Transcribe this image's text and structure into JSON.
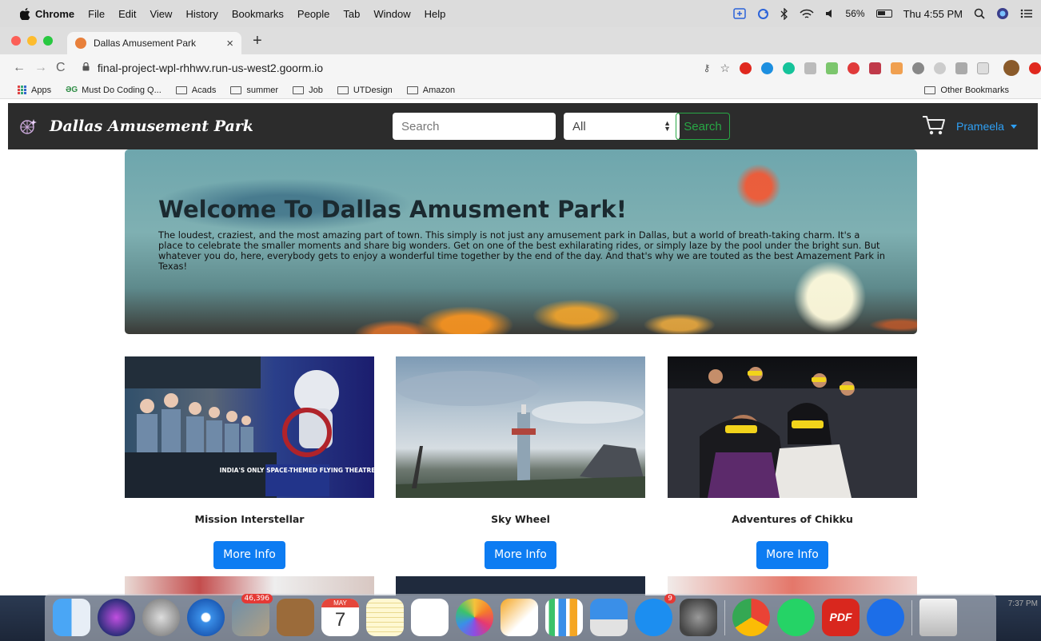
{
  "menubar": {
    "apple": "",
    "items": [
      "Chrome",
      "File",
      "Edit",
      "View",
      "History",
      "Bookmarks",
      "People",
      "Tab",
      "Window",
      "Help"
    ],
    "battery": "56%",
    "clock": "Thu 4:55 PM"
  },
  "browser": {
    "tab_title": "Dallas Amusement Park",
    "tab_close": "×",
    "new_tab": "+",
    "url": "final-project-wpl-rhhwv.run-us-west2.goorm.io",
    "nav": {
      "back": "←",
      "forward": "→",
      "reload": "C"
    }
  },
  "bookmarks": {
    "items": [
      "Apps",
      "Must Do Coding Q...",
      "Acads",
      "summer",
      "Job",
      "UTDesign",
      "Amazon"
    ],
    "other": "Other Bookmarks"
  },
  "site": {
    "brand": "Dallas Amusement Park",
    "search_placeholder": "Search",
    "category": "All",
    "search_button": "Search",
    "user": "Prameela"
  },
  "hero": {
    "title": "Welcome To Dallas Amusment Park!",
    "text": "The loudest, craziest, and the most amazing part of town. This simply is not just any amusement park in Dallas, but a world of breath-taking charm. It's a place to celebrate the smaller moments and share big wonders. Get on one of the best exhilarating rides, or simply laze by the pool under the bright sun. But whatever you do, here, everybody gets to enjoy a wonderful time together by the end of the day. And that's why we are touted as the best Amazement Park in Texas!"
  },
  "cards": [
    {
      "title": "Mission Interstellar",
      "button": "More Info",
      "poster_text": "INDIA'S ONLY SPACE-THEMED FLYING THEATRE"
    },
    {
      "title": "Sky Wheel",
      "button": "More Info"
    },
    {
      "title": "Adventures of Chikku",
      "button": "More Info"
    }
  ],
  "dock": {
    "mail_badge": "46,396",
    "calendar_month": "MAY",
    "calendar_day": "7",
    "appstore_badge": "9",
    "pdf_label": "PDF",
    "time_fragment": "7:37 PM"
  }
}
